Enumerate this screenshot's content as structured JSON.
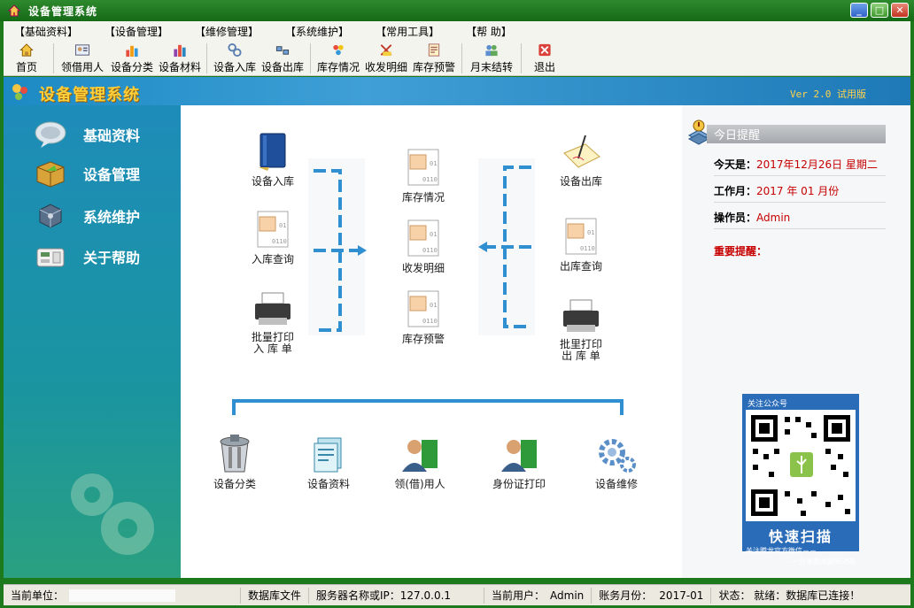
{
  "window": {
    "title": "设备管理系统"
  },
  "menu": [
    "【基础资料】",
    "【设备管理】",
    "【维修管理】",
    "【系统维护】",
    "【常用工具】",
    "【帮    助】"
  ],
  "toolbar": [
    {
      "label": "首页",
      "icon": "home-icon"
    },
    {
      "label": "领借用人",
      "icon": "person-card-icon"
    },
    {
      "label": "设备分类",
      "icon": "bar-chart-icon"
    },
    {
      "label": "设备材料",
      "icon": "materials-icon"
    },
    {
      "label": "设备入库",
      "icon": "inbound-icon"
    },
    {
      "label": "设备出库",
      "icon": "outbound-icon"
    },
    {
      "label": "库存情况",
      "icon": "stock-icon"
    },
    {
      "label": "收发明细",
      "icon": "detail-icon"
    },
    {
      "label": "库存预警",
      "icon": "warning-icon"
    },
    {
      "label": "月末结转",
      "icon": "users-icon"
    },
    {
      "label": "退出",
      "icon": "exit-icon"
    }
  ],
  "header": {
    "brand": "设备管理系统",
    "version": "Ver 2.0 试用版"
  },
  "sidebar": [
    {
      "label": "基础资料",
      "icon": "speech-bubble-icon"
    },
    {
      "label": "设备管理",
      "icon": "box-icon"
    },
    {
      "label": "系统维护",
      "icon": "cube-icon"
    },
    {
      "label": "关于帮助",
      "icon": "phone-icon"
    }
  ],
  "flow": {
    "inbound": "设备入库",
    "inbound_query": "入库查询",
    "batch_print_in_1": "批量打印",
    "batch_print_in_2": "入 库 单",
    "stock": "库存情况",
    "detail": "收发明细",
    "warning": "库存预警",
    "outbound": "设备出库",
    "outbound_query": "出库查询",
    "batch_print_out_1": "批里打印",
    "batch_print_out_2": "出 库 单"
  },
  "bottom_nodes": [
    "设备分类",
    "设备资料",
    "领(借)用人",
    "身份证打印",
    "设备维修"
  ],
  "reminder": {
    "title": "今日提醒",
    "today_label": "今天是：",
    "today_value": "2017年12月26日  星期二",
    "month_label": "工作月：",
    "month_value": "2017 年 01 月份",
    "operator_label": "操作员：",
    "operator_value": "Admin",
    "important_label": "重要提醒："
  },
  "qr": {
    "title": "关注公众号",
    "scan": "快速扫描",
    "sub1": "关注腾龙官方微信－－",
    "sub2": "－－分享腾龙最新动态"
  },
  "status": {
    "unit_label": "当前单位：",
    "db": "数据库文件",
    "server": "服务器名称或IP：127.0.0.1",
    "user_label": "当前用户：",
    "user": "Admin",
    "month_label": "账务月份：",
    "month": "2017-01",
    "state": "状态：  就绪：数据库已连接！"
  },
  "colors": {
    "accent": "#1e8cb9",
    "brand_text": "#ffcf3a",
    "alert": "#c60000",
    "title_bar": "#166a16"
  }
}
